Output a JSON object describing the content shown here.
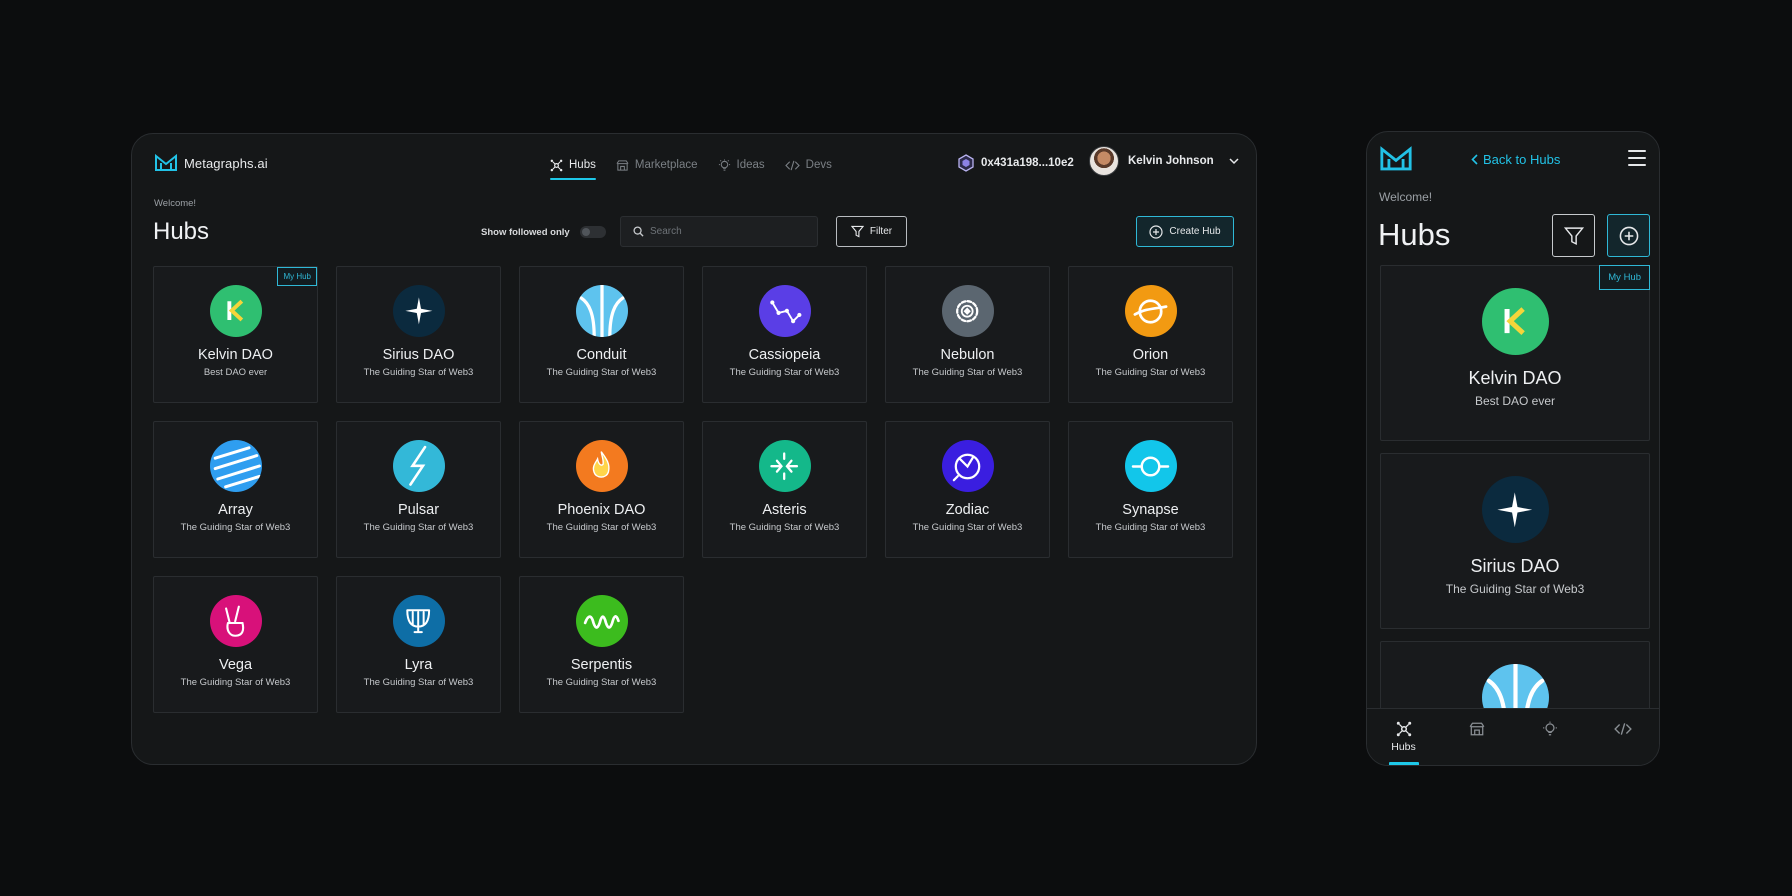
{
  "desktop": {
    "brand": "Metagraphs.ai",
    "nav": [
      {
        "label": "Hubs",
        "icon": "hubs-icon",
        "active": true
      },
      {
        "label": "Marketplace",
        "icon": "store-icon",
        "active": false
      },
      {
        "label": "Ideas",
        "icon": "lightbulb-icon",
        "active": false
      },
      {
        "label": "Devs",
        "icon": "code-icon",
        "active": false
      }
    ],
    "wallet": "0x431a198...10e2",
    "user_name": "Kelvin Johnson",
    "welcome": "Welcome!",
    "title": "Hubs",
    "follow_label": "Show followed only",
    "search_placeholder": "Search",
    "filter_label": "Filter",
    "create_label": "Create Hub",
    "my_hub_badge": "My Hub",
    "hubs": [
      {
        "name": "Kelvin DAO",
        "desc": "Best DAO ever",
        "icon": "kelvin-k-icon",
        "color": "#2fbf71",
        "my_hub": true
      },
      {
        "name": "Sirius DAO",
        "desc": "The Guiding Star of Web3",
        "icon": "star-icon",
        "color": "#0b2a3e"
      },
      {
        "name": "Conduit",
        "desc": "The Guiding Star of Web3",
        "icon": "conduit-icon",
        "color": "#5ec3ee"
      },
      {
        "name": "Cassiopeia",
        "desc": "The Guiding Star of Web3",
        "icon": "constellation-icon",
        "color": "#5a3ee6"
      },
      {
        "name": "Nebulon",
        "desc": "The Guiding Star of Web3",
        "icon": "gear-icon",
        "color": "#5b6670"
      },
      {
        "name": "Orion",
        "desc": "The Guiding Star of Web3",
        "icon": "orbit-icon",
        "color": "#f29a12"
      },
      {
        "name": "Array",
        "desc": "The Guiding Star of Web3",
        "icon": "stripes-icon",
        "color": "#2f9ef0"
      },
      {
        "name": "Pulsar",
        "desc": "The Guiding Star of Web3",
        "icon": "bolt-icon",
        "color": "#33b8d8"
      },
      {
        "name": "Phoenix DAO",
        "desc": "The Guiding Star of Web3",
        "icon": "flame-icon",
        "color": "#f37a1f"
      },
      {
        "name": "Asteris",
        "desc": "The Guiding Star of Web3",
        "icon": "arrows-icon",
        "color": "#14b88a"
      },
      {
        "name": "Zodiac",
        "desc": "The Guiding Star of Web3",
        "icon": "zodiac-icon",
        "color": "#3a1ee0"
      },
      {
        "name": "Synapse",
        "desc": "The Guiding Star of Web3",
        "icon": "target-icon",
        "color": "#12c6ea"
      },
      {
        "name": "Vega",
        "desc": "The Guiding Star of Web3",
        "icon": "peace-hand-icon",
        "color": "#d8117a"
      },
      {
        "name": "Lyra",
        "desc": "The Guiding Star of Web3",
        "icon": "lyre-icon",
        "color": "#0e6ea6"
      },
      {
        "name": "Serpentis",
        "desc": "The Guiding Star of Web3",
        "icon": "serpent-icon",
        "color": "#3cbc1e"
      }
    ]
  },
  "mobile": {
    "back_label": "Back to Hubs",
    "welcome": "Welcome!",
    "title": "Hubs",
    "my_hub_badge": "My Hub",
    "hubs": [
      {
        "name": "Kelvin DAO",
        "desc": "Best DAO ever",
        "icon": "kelvin-k-icon",
        "color": "#2fbf71",
        "my_hub": true
      },
      {
        "name": "Sirius DAO",
        "desc": "The Guiding Star of Web3",
        "icon": "star-icon",
        "color": "#0b2a3e"
      },
      {
        "name": "",
        "desc": "",
        "icon": "conduit-icon",
        "color": "#5ec3ee"
      }
    ],
    "tabs": [
      {
        "label": "Hubs",
        "icon": "hubs-icon",
        "active": true
      },
      {
        "label": "",
        "icon": "store-icon",
        "active": false
      },
      {
        "label": "",
        "icon": "lightbulb-icon",
        "active": false
      },
      {
        "label": "",
        "icon": "code-icon",
        "active": false
      }
    ]
  },
  "colors": {
    "accent": "#1ec8e8",
    "background": "#0c0d0e",
    "panel": "#151718"
  }
}
